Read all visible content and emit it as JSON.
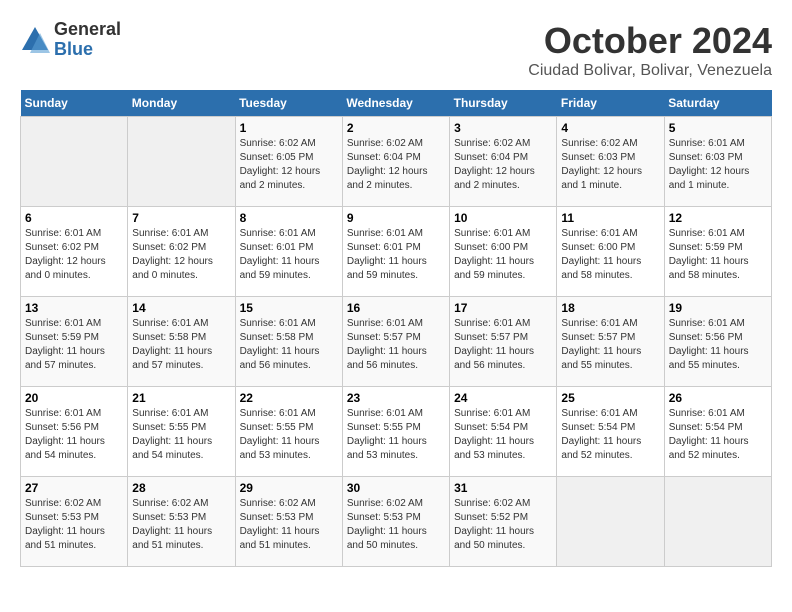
{
  "logo": {
    "general": "General",
    "blue": "Blue"
  },
  "title": "October 2024",
  "subtitle": "Ciudad Bolivar, Bolivar, Venezuela",
  "days_header": [
    "Sunday",
    "Monday",
    "Tuesday",
    "Wednesday",
    "Thursday",
    "Friday",
    "Saturday"
  ],
  "weeks": [
    [
      {
        "day": "",
        "info": ""
      },
      {
        "day": "",
        "info": ""
      },
      {
        "day": "1",
        "info": "Sunrise: 6:02 AM\nSunset: 6:05 PM\nDaylight: 12 hours\nand 2 minutes."
      },
      {
        "day": "2",
        "info": "Sunrise: 6:02 AM\nSunset: 6:04 PM\nDaylight: 12 hours\nand 2 minutes."
      },
      {
        "day": "3",
        "info": "Sunrise: 6:02 AM\nSunset: 6:04 PM\nDaylight: 12 hours\nand 2 minutes."
      },
      {
        "day": "4",
        "info": "Sunrise: 6:02 AM\nSunset: 6:03 PM\nDaylight: 12 hours\nand 1 minute."
      },
      {
        "day": "5",
        "info": "Sunrise: 6:01 AM\nSunset: 6:03 PM\nDaylight: 12 hours\nand 1 minute."
      }
    ],
    [
      {
        "day": "6",
        "info": "Sunrise: 6:01 AM\nSunset: 6:02 PM\nDaylight: 12 hours\nand 0 minutes."
      },
      {
        "day": "7",
        "info": "Sunrise: 6:01 AM\nSunset: 6:02 PM\nDaylight: 12 hours\nand 0 minutes."
      },
      {
        "day": "8",
        "info": "Sunrise: 6:01 AM\nSunset: 6:01 PM\nDaylight: 11 hours\nand 59 minutes."
      },
      {
        "day": "9",
        "info": "Sunrise: 6:01 AM\nSunset: 6:01 PM\nDaylight: 11 hours\nand 59 minutes."
      },
      {
        "day": "10",
        "info": "Sunrise: 6:01 AM\nSunset: 6:00 PM\nDaylight: 11 hours\nand 59 minutes."
      },
      {
        "day": "11",
        "info": "Sunrise: 6:01 AM\nSunset: 6:00 PM\nDaylight: 11 hours\nand 58 minutes."
      },
      {
        "day": "12",
        "info": "Sunrise: 6:01 AM\nSunset: 5:59 PM\nDaylight: 11 hours\nand 58 minutes."
      }
    ],
    [
      {
        "day": "13",
        "info": "Sunrise: 6:01 AM\nSunset: 5:59 PM\nDaylight: 11 hours\nand 57 minutes."
      },
      {
        "day": "14",
        "info": "Sunrise: 6:01 AM\nSunset: 5:58 PM\nDaylight: 11 hours\nand 57 minutes."
      },
      {
        "day": "15",
        "info": "Sunrise: 6:01 AM\nSunset: 5:58 PM\nDaylight: 11 hours\nand 56 minutes."
      },
      {
        "day": "16",
        "info": "Sunrise: 6:01 AM\nSunset: 5:57 PM\nDaylight: 11 hours\nand 56 minutes."
      },
      {
        "day": "17",
        "info": "Sunrise: 6:01 AM\nSunset: 5:57 PM\nDaylight: 11 hours\nand 56 minutes."
      },
      {
        "day": "18",
        "info": "Sunrise: 6:01 AM\nSunset: 5:57 PM\nDaylight: 11 hours\nand 55 minutes."
      },
      {
        "day": "19",
        "info": "Sunrise: 6:01 AM\nSunset: 5:56 PM\nDaylight: 11 hours\nand 55 minutes."
      }
    ],
    [
      {
        "day": "20",
        "info": "Sunrise: 6:01 AM\nSunset: 5:56 PM\nDaylight: 11 hours\nand 54 minutes."
      },
      {
        "day": "21",
        "info": "Sunrise: 6:01 AM\nSunset: 5:55 PM\nDaylight: 11 hours\nand 54 minutes."
      },
      {
        "day": "22",
        "info": "Sunrise: 6:01 AM\nSunset: 5:55 PM\nDaylight: 11 hours\nand 53 minutes."
      },
      {
        "day": "23",
        "info": "Sunrise: 6:01 AM\nSunset: 5:55 PM\nDaylight: 11 hours\nand 53 minutes."
      },
      {
        "day": "24",
        "info": "Sunrise: 6:01 AM\nSunset: 5:54 PM\nDaylight: 11 hours\nand 53 minutes."
      },
      {
        "day": "25",
        "info": "Sunrise: 6:01 AM\nSunset: 5:54 PM\nDaylight: 11 hours\nand 52 minutes."
      },
      {
        "day": "26",
        "info": "Sunrise: 6:01 AM\nSunset: 5:54 PM\nDaylight: 11 hours\nand 52 minutes."
      }
    ],
    [
      {
        "day": "27",
        "info": "Sunrise: 6:02 AM\nSunset: 5:53 PM\nDaylight: 11 hours\nand 51 minutes."
      },
      {
        "day": "28",
        "info": "Sunrise: 6:02 AM\nSunset: 5:53 PM\nDaylight: 11 hours\nand 51 minutes."
      },
      {
        "day": "29",
        "info": "Sunrise: 6:02 AM\nSunset: 5:53 PM\nDaylight: 11 hours\nand 51 minutes."
      },
      {
        "day": "30",
        "info": "Sunrise: 6:02 AM\nSunset: 5:53 PM\nDaylight: 11 hours\nand 50 minutes."
      },
      {
        "day": "31",
        "info": "Sunrise: 6:02 AM\nSunset: 5:52 PM\nDaylight: 11 hours\nand 50 minutes."
      },
      {
        "day": "",
        "info": ""
      },
      {
        "day": "",
        "info": ""
      }
    ]
  ]
}
